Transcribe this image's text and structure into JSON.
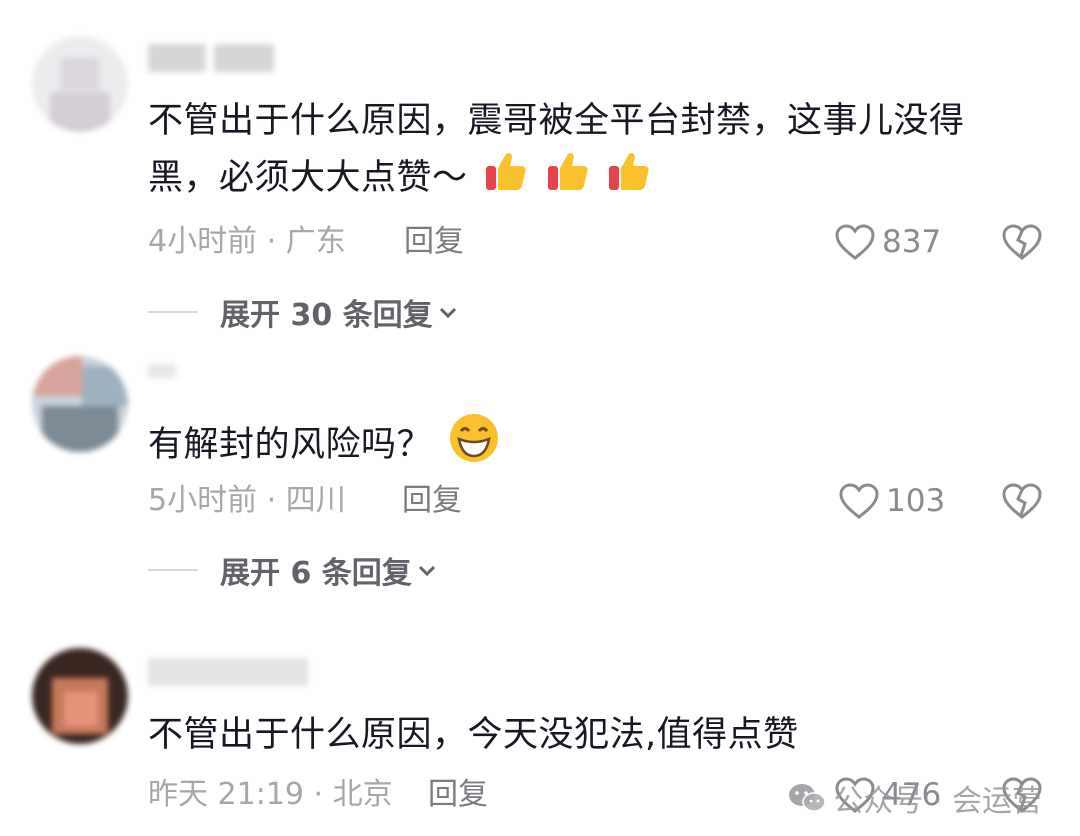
{
  "comments": [
    {
      "text_line1": "不管出于什么原因，震哥被全平台封禁，这事儿没得",
      "text_line2": "黑，必须大大点赞～",
      "emoji": [
        "thumbs-up",
        "thumbs-up",
        "thumbs-up"
      ],
      "time_location": "4小时前 · 广东",
      "reply_label": "回复",
      "likes": "837",
      "expand_label": "展开 30 条回复",
      "avatar_colors": [
        "#ececee",
        "#e4e2e6",
        "#d9d5db",
        "#efefef"
      ]
    },
    {
      "text_line1": "有解封的风险吗？",
      "emoji": [
        "grinning-face"
      ],
      "time_location": "5小时前 · 四川",
      "reply_label": "回复",
      "likes": "103",
      "expand_label": "展开 6 条回复",
      "avatar_colors": [
        "#c9d3dc",
        "#a8b6c2",
        "#7f8c99",
        "#dfe5ea"
      ]
    },
    {
      "text_line1": "不管出于什么原因，今天没犯法,值得点赞",
      "time_location": "昨天 21:19 · 北京",
      "reply_label": "回复",
      "likes": "476",
      "avatar_colors": [
        "#3a2620",
        "#b06a4f",
        "#e08b6a",
        "#6b3f30"
      ]
    }
  ],
  "watermark": {
    "text": "公众号 · 会运营",
    "icon": "wechat-icon"
  },
  "colors": {
    "text": "#161823",
    "meta": "#a6a7ab",
    "reply": "#7a7b80"
  }
}
